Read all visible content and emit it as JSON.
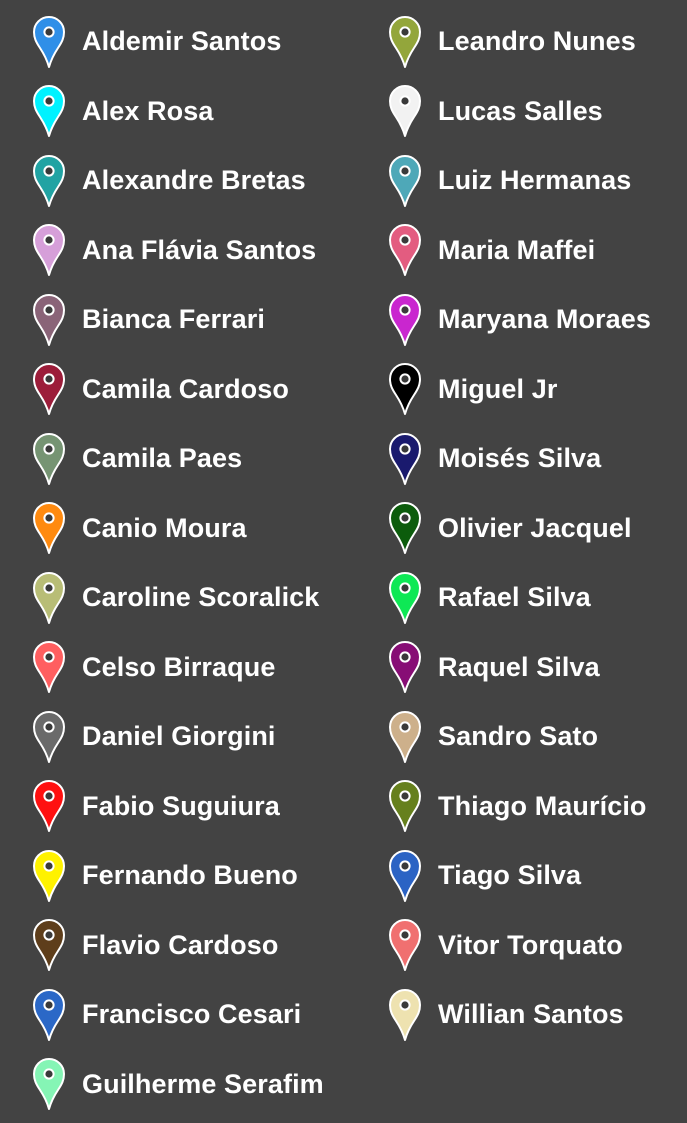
{
  "legend": {
    "columns": [
      {
        "items": [
          {
            "label": "Aldemir Santos",
            "color": "#2f8fe8",
            "icon": "map-pin-icon"
          },
          {
            "label": "Alex Rosa",
            "color": "#00f2ff",
            "icon": "map-pin-icon"
          },
          {
            "label": "Alexandre Bretas",
            "color": "#21a3a3",
            "icon": "map-pin-icon"
          },
          {
            "label": "Ana Flávia Santos",
            "color": "#d69fd9",
            "icon": "map-pin-icon"
          },
          {
            "label": "Bianca Ferrari",
            "color": "#8a6478",
            "icon": "map-pin-icon"
          },
          {
            "label": "Camila Cardoso",
            "color": "#9c1d3a",
            "icon": "map-pin-icon"
          },
          {
            "label": "Camila Paes",
            "color": "#769473",
            "icon": "map-pin-icon"
          },
          {
            "label": "Canio Moura",
            "color": "#ff8a0f",
            "icon": "map-pin-icon"
          },
          {
            "label": "Caroline Scoralick",
            "color": "#b8bd76",
            "icon": "map-pin-icon"
          },
          {
            "label": "Celso Birraque",
            "color": "#ff5f60",
            "icon": "map-pin-icon"
          },
          {
            "label": "Daniel Giorgini",
            "color": "#6a6a6a",
            "icon": "map-pin-icon"
          },
          {
            "label": "Fabio Suguiura",
            "color": "#ff1010",
            "icon": "map-pin-icon"
          },
          {
            "label": "Fernando Bueno",
            "color": "#fff200",
            "icon": "map-pin-icon"
          },
          {
            "label": "Flavio Cardoso",
            "color": "#5e3e1b",
            "icon": "map-pin-icon"
          },
          {
            "label": "Francisco Cesari",
            "color": "#2b68c7",
            "icon": "map-pin-icon"
          },
          {
            "label": "Guilherme Serafim",
            "color": "#85f5b5",
            "icon": "map-pin-icon"
          }
        ]
      },
      {
        "items": [
          {
            "label": "Leandro Nunes",
            "color": "#93a63b",
            "icon": "map-pin-icon"
          },
          {
            "label": "Lucas Salles",
            "color": "#f2f2f2",
            "icon": "map-pin-icon"
          },
          {
            "label": "Luiz Hermanas",
            "color": "#4ea8b8",
            "icon": "map-pin-icon"
          },
          {
            "label": "Maria Maffei",
            "color": "#e35c80",
            "icon": "map-pin-icon"
          },
          {
            "label": "Maryana Moraes",
            "color": "#c926cf",
            "icon": "map-pin-icon"
          },
          {
            "label": "Miguel Jr",
            "color": "#000000",
            "icon": "map-pin-icon"
          },
          {
            "label": "Moisés Silva",
            "color": "#1a1a6e",
            "icon": "map-pin-icon"
          },
          {
            "label": "Olivier Jacquel",
            "color": "#0c5c0c",
            "icon": "map-pin-icon"
          },
          {
            "label": "Rafael Silva",
            "color": "#0ee855",
            "icon": "map-pin-icon"
          },
          {
            "label": "Raquel Silva",
            "color": "#870d75",
            "icon": "map-pin-icon"
          },
          {
            "label": "Sandro Sato",
            "color": "#cdb08b",
            "icon": "map-pin-icon"
          },
          {
            "label": "Thiago Maurício",
            "color": "#66801d",
            "icon": "map-pin-icon"
          },
          {
            "label": "Tiago Silva",
            "color": "#2b63c4",
            "icon": "map-pin-icon"
          },
          {
            "label": "Vitor Torquato",
            "color": "#f07070",
            "icon": "map-pin-icon"
          },
          {
            "label": "Willian Santos",
            "color": "#eee2b0",
            "icon": "map-pin-icon"
          }
        ]
      }
    ]
  }
}
